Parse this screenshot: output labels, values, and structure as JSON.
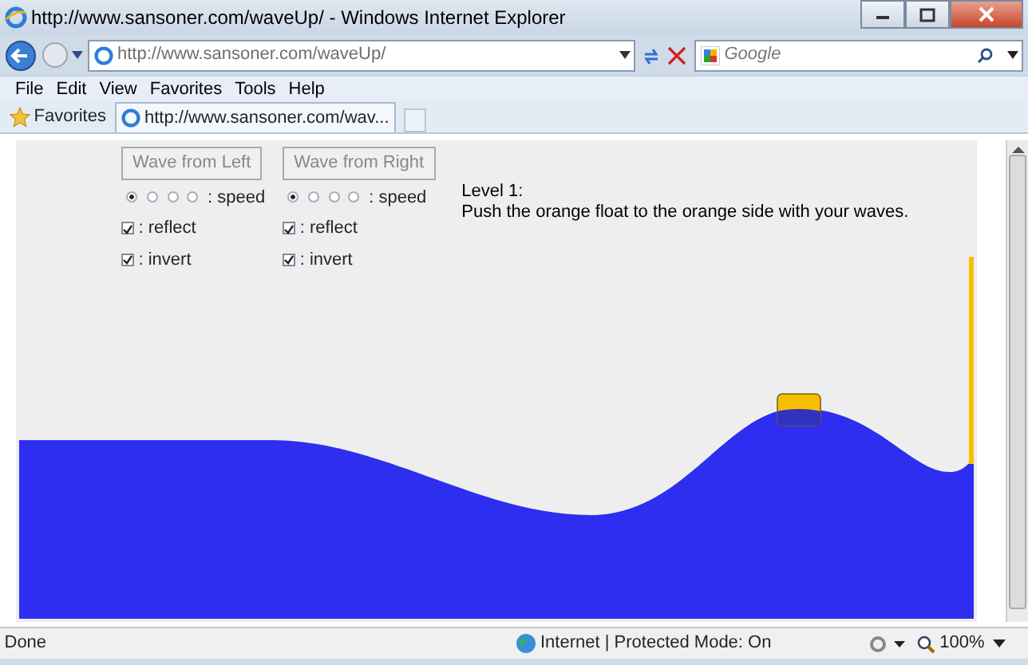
{
  "window": {
    "title": "http://www.sansoner.com/waveUp/ - Windows Internet Explorer"
  },
  "address_bar": {
    "url": "http://www.sansoner.com/waveUp/"
  },
  "search": {
    "placeholder": "Google"
  },
  "menu": [
    "File",
    "Edit",
    "View",
    "Favorites",
    "Tools",
    "Help"
  ],
  "favorites": {
    "label": "Favorites"
  },
  "tab": {
    "title": "http://www.sansoner.com/wav..."
  },
  "page": {
    "panels": [
      {
        "button": "Wave from Left",
        "speeds": [
          {
            "selected": true
          },
          {
            "selected": false
          },
          {
            "selected": false
          },
          {
            "selected": false
          }
        ],
        "speed_label": ": speed",
        "reflect": {
          "label": ": reflect",
          "checked": true
        },
        "invert": {
          "label": ": invert",
          "checked": true
        }
      },
      {
        "button": "Wave from Right",
        "speeds": [
          {
            "selected": true
          },
          {
            "selected": false
          },
          {
            "selected": false
          },
          {
            "selected": false
          }
        ],
        "speed_label": ": speed",
        "reflect": {
          "label": ": reflect",
          "checked": true
        },
        "invert": {
          "label": ": invert",
          "checked": true
        }
      }
    ],
    "level": {
      "title": "Level 1:",
      "instructions": "Push the orange float to the orange side with your waves."
    }
  },
  "status_bar": {
    "text": "Done",
    "zone": "Internet | Protected Mode: On",
    "zoom": "100%"
  }
}
